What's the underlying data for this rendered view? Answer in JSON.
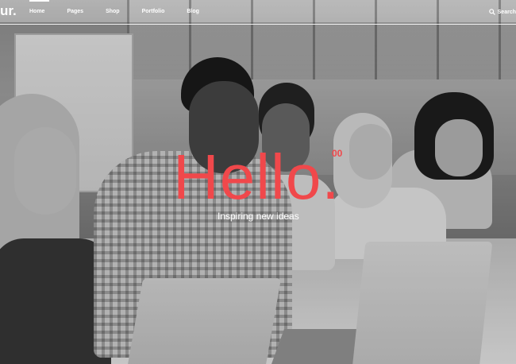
{
  "brand": {
    "logo_text": "ur."
  },
  "nav": {
    "items": [
      {
        "label": "Home",
        "active": true
      },
      {
        "label": "Pages"
      },
      {
        "label": "Shop"
      },
      {
        "label": "Portfolio"
      },
      {
        "label": "Blog"
      }
    ],
    "search_label": "Search"
  },
  "hero": {
    "title": "Hello.",
    "superscript": "00",
    "tagline": "Inspiring new ideas",
    "accent_color": "#f0484b"
  }
}
